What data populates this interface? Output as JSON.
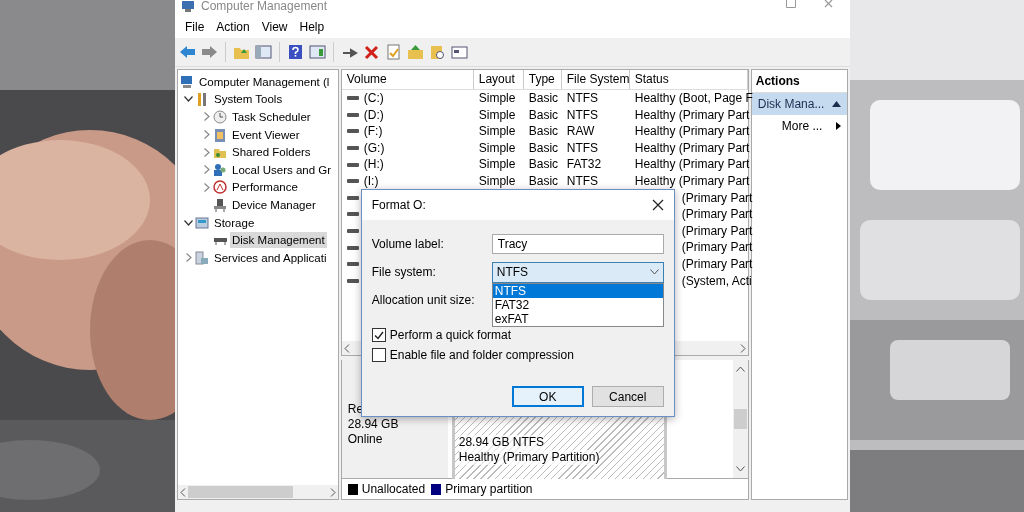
{
  "window": {
    "title": "Computer Management"
  },
  "menu": [
    "File",
    "Action",
    "View",
    "Help"
  ],
  "tree": [
    {
      "label": "Computer Management (l",
      "selected": false,
      "children": [
        {
          "label": "System Tools",
          "expanded": true,
          "selected": false,
          "children": [
            {
              "label": "Task Scheduler",
              "expanded": false,
              "selected": false
            },
            {
              "label": "Event Viewer",
              "expanded": false,
              "selected": false
            },
            {
              "label": "Shared Folders",
              "expanded": false,
              "selected": false
            },
            {
              "label": "Local Users and Gr",
              "expanded": false,
              "selected": false
            },
            {
              "label": "Performance",
              "expanded": false,
              "selected": false
            },
            {
              "label": "Device Manager",
              "selected": false
            }
          ]
        },
        {
          "label": "Storage",
          "expanded": true,
          "selected": false,
          "children": [
            {
              "label": "Disk Management",
              "selected": true
            }
          ]
        },
        {
          "label": "Services and Applicati",
          "expanded": false,
          "selected": false
        }
      ]
    }
  ],
  "table": {
    "columns": [
      "Volume",
      "Layout",
      "Type",
      "File System",
      "Status"
    ],
    "rows": [
      {
        "kind": "volume",
        "volume": "(C:)",
        "layout": "Simple",
        "type": "Basic",
        "file_system": "NTFS",
        "status": "Healthy (Boot, Page F"
      },
      {
        "kind": "volume",
        "volume": "(D:)",
        "layout": "Simple",
        "type": "Basic",
        "file_system": "NTFS",
        "status": "Healthy (Primary Part"
      },
      {
        "kind": "volume",
        "volume": "(F:)",
        "layout": "Simple",
        "type": "Basic",
        "file_system": "RAW",
        "status": "Healthy (Primary Part"
      },
      {
        "kind": "volume",
        "volume": "(G:)",
        "layout": "Simple",
        "type": "Basic",
        "file_system": "NTFS",
        "status": "Healthy (Primary Part"
      },
      {
        "kind": "volume",
        "volume": "(H:)",
        "layout": "Simple",
        "type": "Basic",
        "file_system": "FAT32",
        "status": "Healthy (Primary Part"
      },
      {
        "kind": "volume",
        "volume": "(I:)",
        "layout": "Simple",
        "type": "Basic",
        "file_system": "NTFS",
        "status": "Healthy (Primary Part"
      },
      {
        "kind": "covered",
        "status": "(Primary Part"
      },
      {
        "kind": "covered",
        "status": "(Primary Part"
      },
      {
        "kind": "covered",
        "status": "(Primary Part"
      },
      {
        "kind": "covered",
        "status": "(Primary Part"
      },
      {
        "kind": "covered",
        "status": "(Primary Part"
      },
      {
        "kind": "covered",
        "status": "(System, Acti"
      }
    ]
  },
  "disk": {
    "name": "Re",
    "capacity": "28.94 GB",
    "state": "Online",
    "partition": {
      "size": "28.94 GB NTFS",
      "status": "Healthy (Primary Partition)"
    }
  },
  "legend": [
    {
      "label": "Unallocated",
      "color": "#000000"
    },
    {
      "label": "Primary partition",
      "color": "#000080"
    }
  ],
  "actions": {
    "title": "Actions",
    "items": [
      {
        "label": "Disk Mana...",
        "kind": "section"
      },
      {
        "label": "More ...",
        "kind": "more"
      }
    ]
  },
  "dialog": {
    "title": "Format O:",
    "fields": [
      {
        "label": "Volume label:",
        "kind": "text",
        "value": "Tracy"
      },
      {
        "label": "File system:",
        "kind": "combo",
        "value": "NTFS",
        "expanded": true,
        "options": [
          {
            "label": "NTFS",
            "selected": true
          },
          {
            "label": "FAT32",
            "selected": false
          },
          {
            "label": "exFAT",
            "selected": false
          }
        ]
      },
      {
        "label": "Allocation unit size:",
        "kind": "covered"
      }
    ],
    "checkboxes": [
      {
        "label": "Perform a quick format",
        "checked": true
      },
      {
        "label": "Enable file and folder compression",
        "checked": false
      }
    ],
    "buttons": [
      {
        "label": "OK",
        "default": true
      },
      {
        "label": "Cancel",
        "default": false
      }
    ]
  }
}
